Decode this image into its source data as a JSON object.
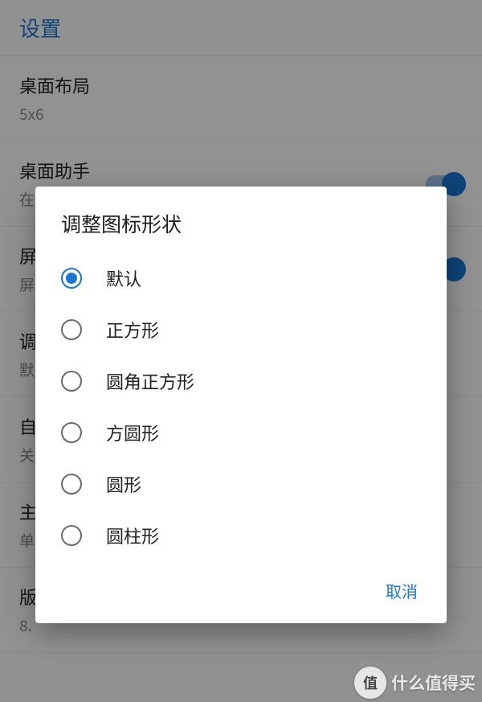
{
  "header": {
    "title": "设置"
  },
  "rows": {
    "layout": {
      "title": "桌面布局",
      "sub": "5x6"
    },
    "assist": {
      "title": "桌面助手",
      "sub": "在桌面的最左屏显示"
    },
    "r2t": "屏",
    "r2s": "屏",
    "r3t": "调",
    "r3s": "默",
    "r4t": "自",
    "r4s": "关",
    "r5t": "主",
    "r5s": "单",
    "r6t": "版",
    "r6s": "8."
  },
  "dialog": {
    "title": "调整图标形状",
    "options": [
      "默认",
      "正方形",
      "圆角正方形",
      "方圆形",
      "圆形",
      "圆柱形"
    ],
    "cancel": "取消"
  },
  "watermark": {
    "badge": "值",
    "text": "什么值得买"
  }
}
